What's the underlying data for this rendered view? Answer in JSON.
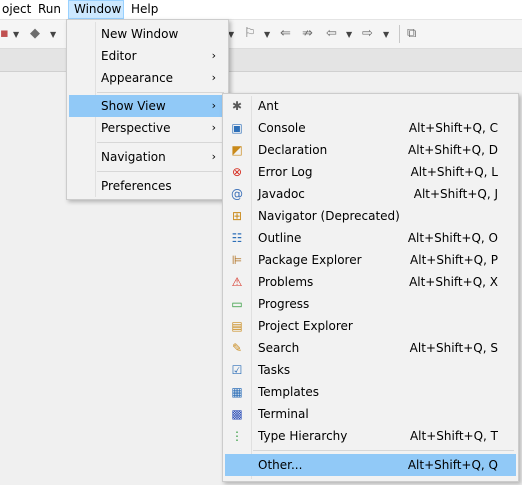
{
  "menubar": {
    "items": [
      {
        "label": "oject"
      },
      {
        "label": "Run"
      },
      {
        "label": "Window"
      },
      {
        "label": "Help"
      }
    ]
  },
  "window_menu": {
    "items": [
      {
        "label": "New Window",
        "arrow": ""
      },
      {
        "label": "Editor",
        "arrow": "›"
      },
      {
        "label": "Appearance",
        "arrow": "›"
      },
      {
        "label": "Show View",
        "arrow": "›"
      },
      {
        "label": "Perspective",
        "arrow": "›"
      },
      {
        "label": "Navigation",
        "arrow": "›"
      },
      {
        "label": "Preferences",
        "arrow": ""
      }
    ]
  },
  "show_view_menu": {
    "items": [
      {
        "label": "Ant",
        "shortcut": "",
        "icon": "ant-icon",
        "glyph": "✱",
        "color": "#5a5a5a"
      },
      {
        "label": "Console",
        "shortcut": "Alt+Shift+Q, C",
        "icon": "console-icon",
        "glyph": "▣",
        "color": "#2d6fb8"
      },
      {
        "label": "Declaration",
        "shortcut": "Alt+Shift+Q, D",
        "icon": "declaration-icon",
        "glyph": "◩",
        "color": "#c98a1b"
      },
      {
        "label": "Error Log",
        "shortcut": "Alt+Shift+Q, L",
        "icon": "error-log-icon",
        "glyph": "⊗",
        "color": "#d62d20"
      },
      {
        "label": "Javadoc",
        "shortcut": "Alt+Shift+Q, J",
        "icon": "javadoc-icon",
        "glyph": "@",
        "color": "#3a6fb8"
      },
      {
        "label": "Navigator (Deprecated)",
        "shortcut": "",
        "icon": "navigator-icon",
        "glyph": "⊞",
        "color": "#c98a1b"
      },
      {
        "label": "Outline",
        "shortcut": "Alt+Shift+Q, O",
        "icon": "outline-icon",
        "glyph": "☷",
        "color": "#2d6fb8"
      },
      {
        "label": "Package Explorer",
        "shortcut": "Alt+Shift+Q, P",
        "icon": "package-explorer-icon",
        "glyph": "⊫",
        "color": "#b07020"
      },
      {
        "label": "Problems",
        "shortcut": "Alt+Shift+Q, X",
        "icon": "problems-icon",
        "glyph": "⚠",
        "color": "#d62d20"
      },
      {
        "label": "Progress",
        "shortcut": "",
        "icon": "progress-icon",
        "glyph": "▭",
        "color": "#2e9a3a"
      },
      {
        "label": "Project Explorer",
        "shortcut": "",
        "icon": "project-explorer-icon",
        "glyph": "▤",
        "color": "#c98a1b"
      },
      {
        "label": "Search",
        "shortcut": "Alt+Shift+Q, S",
        "icon": "search-icon",
        "glyph": "✎",
        "color": "#c98a1b"
      },
      {
        "label": "Tasks",
        "shortcut": "",
        "icon": "tasks-icon",
        "glyph": "☑",
        "color": "#2d6fb8"
      },
      {
        "label": "Templates",
        "shortcut": "",
        "icon": "templates-icon",
        "glyph": "▦",
        "color": "#2d6fb8"
      },
      {
        "label": "Terminal",
        "shortcut": "",
        "icon": "terminal-icon",
        "glyph": "▩",
        "color": "#2d4fb8"
      },
      {
        "label": "Type Hierarchy",
        "shortcut": "Alt+Shift+Q, T",
        "icon": "type-hierarchy-icon",
        "glyph": "⋮",
        "color": "#2e9a3a"
      },
      {
        "label": "Other...",
        "shortcut": "Alt+Shift+Q, Q",
        "icon": "",
        "glyph": "",
        "color": "#000000"
      }
    ]
  },
  "colors": {
    "highlight": "#91c9f7",
    "menubar_active": "#cce8ff",
    "menu_bg": "#f2f2f2"
  }
}
